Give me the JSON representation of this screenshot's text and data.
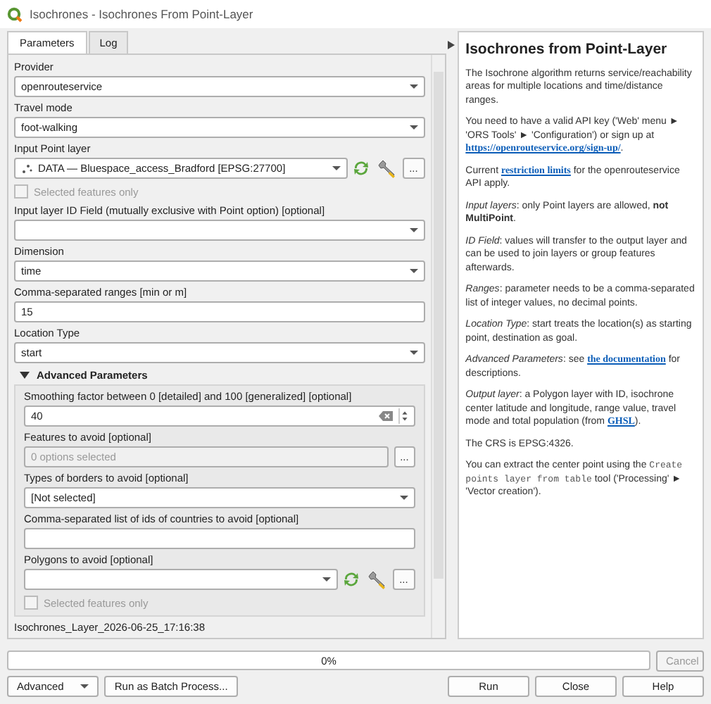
{
  "window": {
    "title": "Isochrones - Isochrones From Point-Layer"
  },
  "tabs": [
    {
      "label": "Parameters",
      "selected": true
    },
    {
      "label": "Log",
      "selected": false
    }
  ],
  "parameters": [
    {
      "kind": "select",
      "label": "Provider",
      "value": "openrouteservice"
    },
    {
      "kind": "select",
      "label": "Travel mode",
      "value": "foot-walking"
    },
    {
      "kind": "layer",
      "label": "Input Point layer",
      "value": "DATA — Bluespace_access_Bradford [EPSG:27700]",
      "browse": "..."
    },
    {
      "kind": "checkbox",
      "label": "Selected features only",
      "checked": false,
      "disabled": true
    },
    {
      "kind": "select",
      "label": "Input layer ID Field (mutually exclusive with Point option) [optional]"
    },
    {
      "kind": "select",
      "label": "Dimension",
      "value": "time"
    },
    {
      "kind": "text",
      "label": "Comma-separated ranges [min or m]",
      "value": "15"
    },
    {
      "kind": "select",
      "label": "Location Type",
      "value": "start"
    }
  ],
  "advanced": {
    "title": "Advanced Parameters",
    "expanded": true,
    "parameters": [
      {
        "kind": "spin",
        "label": "Smoothing factor between 0 [detailed] and 100 [generalized] [optional]",
        "value": "40"
      },
      {
        "kind": "multi",
        "label": "Features to avoid [optional]",
        "placeholder": "0 options selected",
        "browse": "..."
      },
      {
        "kind": "select",
        "label": "Types of borders to avoid [optional]",
        "value": "[Not selected]"
      },
      {
        "kind": "text",
        "label": "Comma-separated list of ids of countries to avoid [optional]"
      },
      {
        "kind": "layer",
        "label": "Polygons to avoid [optional]",
        "browse": "..."
      },
      {
        "kind": "checkbox",
        "label": "Selected features only",
        "checked": false,
        "disabled": true
      }
    ]
  },
  "output_name": "Isochrones_Layer_2026-06-25_17:16:38",
  "help": {
    "title": "Isochrones from Point-Layer",
    "paragraphs": [
      [
        {
          "kind": "text",
          "text": "The Isochrone algorithm returns service/reachability areas for multiple locations and time/distance ranges."
        }
      ],
      [
        {
          "kind": "text",
          "text": "You need to have a valid API key ('Web' menu ► 'ORS Tools' ► 'Configuration') or sign up at "
        },
        {
          "kind": "link",
          "text": "https://openrouteservice.org/sign-up/"
        },
        {
          "kind": "text",
          "text": "."
        }
      ],
      [
        {
          "kind": "text",
          "text": "Current "
        },
        {
          "kind": "link",
          "text": "restriction limits"
        },
        {
          "kind": "text",
          "text": " for the openrouteservice API apply."
        }
      ],
      [
        {
          "kind": "text",
          "text": "*Input layers*: only Point layers are allowed, **not MultiPoint**."
        }
      ],
      [
        {
          "kind": "text",
          "text": "*ID Field*: values will transfer to the output layer and can be used to join layers or group features afterwards."
        }
      ],
      [
        {
          "kind": "text",
          "text": "*Ranges*: parameter needs to be a comma-separated list of integer values, no decimal points."
        }
      ],
      [
        {
          "kind": "text",
          "text": "*Location Type*: start treats the location(s) as starting point, destination as goal."
        }
      ],
      [
        {
          "kind": "text",
          "text": "*Advanced Parameters*: see "
        },
        {
          "kind": "link",
          "text": "the documentation"
        },
        {
          "kind": "text",
          "text": " for descriptions."
        }
      ],
      [
        {
          "kind": "text",
          "text": "*Output layer*: a Polygon layer with ID, isochrone center latitude and longitude, range value, travel mode and total population (from "
        },
        {
          "kind": "link",
          "text": "GHSL"
        },
        {
          "kind": "text",
          "text": ")."
        }
      ],
      [
        {
          "kind": "text",
          "text": "The CRS is EPSG:4326."
        }
      ],
      [
        {
          "kind": "text",
          "text": "You can extract the center point using the "
        },
        {
          "kind": "code",
          "text": "Create points layer from table"
        },
        {
          "kind": "text",
          "text": " tool ('Processing' ► 'Vector creation')."
        }
      ]
    ]
  },
  "progress": {
    "level": 0,
    "reading": "0%"
  },
  "left_buttons": [
    {
      "label": "Advanced",
      "dropdown": true
    },
    {
      "label": "Run as Batch Process...",
      "dropdown": false
    }
  ],
  "cancel_button": {
    "label": "Cancel",
    "disabled": true
  },
  "right_buttons": [
    {
      "label": "Run"
    },
    {
      "label": "Close"
    },
    {
      "label": "Help"
    }
  ]
}
